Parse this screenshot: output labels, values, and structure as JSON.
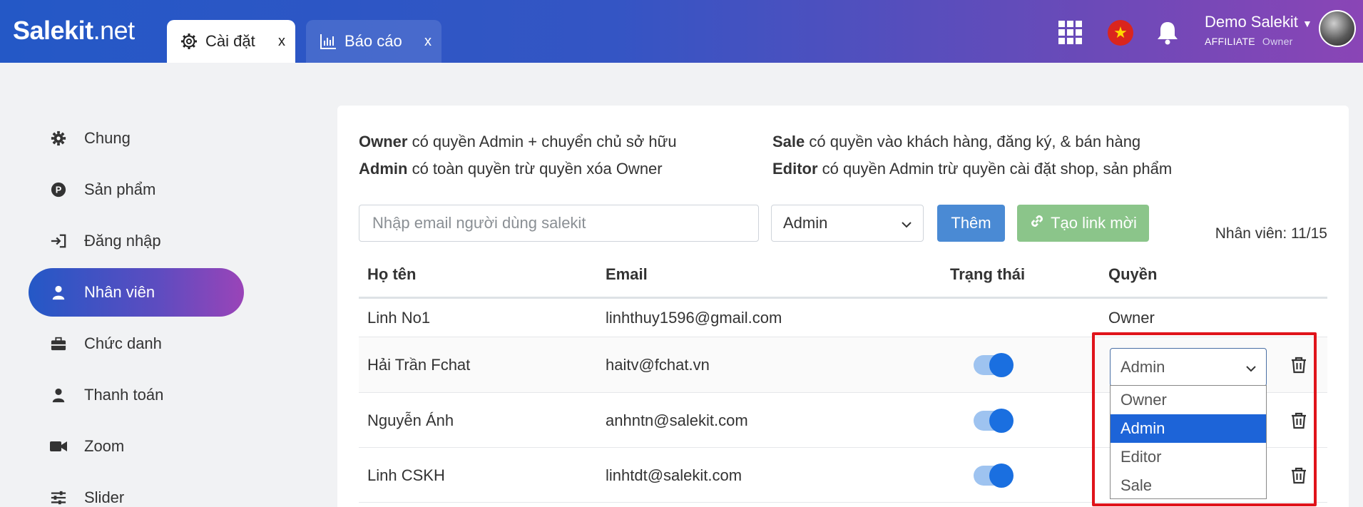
{
  "header": {
    "logo_main": "Salekit",
    "logo_suffix": ".net",
    "tabs": [
      {
        "label": "Cài đặt",
        "close": "x"
      },
      {
        "label": "Báo cáo",
        "close": "x"
      }
    ],
    "user": {
      "name": "Demo Salekit",
      "tier": "AFFILIATE",
      "role": "Owner"
    },
    "flag_star": "★"
  },
  "sidebar": {
    "items": [
      {
        "label": "Chung",
        "icon": "gear-icon"
      },
      {
        "label": "Sản phẩm",
        "icon": "product-icon"
      },
      {
        "label": "Đăng nhập",
        "icon": "login-icon"
      },
      {
        "label": "Nhân viên",
        "icon": "user-icon",
        "active": true
      },
      {
        "label": "Chức danh",
        "icon": "briefcase-icon"
      },
      {
        "label": "Thanh toán",
        "icon": "user-icon"
      },
      {
        "label": "Zoom",
        "icon": "video-icon"
      },
      {
        "label": "Slider",
        "icon": "sliders-icon"
      }
    ]
  },
  "permissions": {
    "owner_term": "Owner",
    "owner_desc": " có quyền Admin + chuyển chủ sở hữu",
    "admin_term": "Admin",
    "admin_desc": " có toàn quyền trừ quyền xóa Owner",
    "sale_term": "Sale",
    "sale_desc": " có quyền vào khách hàng, đăng ký, & bán hàng",
    "editor_term": "Editor",
    "editor_desc": " có quyền Admin trừ quyền cài đặt shop, sản phẩm"
  },
  "form": {
    "email_placeholder": "Nhập email người dùng salekit",
    "role_value": "Admin",
    "add_label": "Thêm",
    "invite_label": "Tạo link mời",
    "count_label": "Nhân viên: 11/15"
  },
  "table": {
    "headers": [
      "Họ tên",
      "Email",
      "Trạng thái",
      "Quyền"
    ],
    "rows": [
      {
        "name": "Linh No1",
        "email": "linhthuy1596@gmail.com",
        "role": "Owner"
      },
      {
        "name": "Hải Trần Fchat",
        "email": "haitv@fchat.vn",
        "role": "Admin"
      },
      {
        "name": "Nguyễn Ánh",
        "email": "anhntn@salekit.com"
      },
      {
        "name": "Linh CSKH",
        "email": "linhtdt@salekit.com"
      }
    ],
    "dropdown_options": [
      "Owner",
      "Admin",
      "Editor",
      "Sale"
    ],
    "dropdown_selected": "Admin"
  },
  "colors": {
    "accent": "#1d64d8",
    "highlight": "#e0141b",
    "add_button": "#4a8ad4",
    "invite_button": "#8bc58a"
  }
}
